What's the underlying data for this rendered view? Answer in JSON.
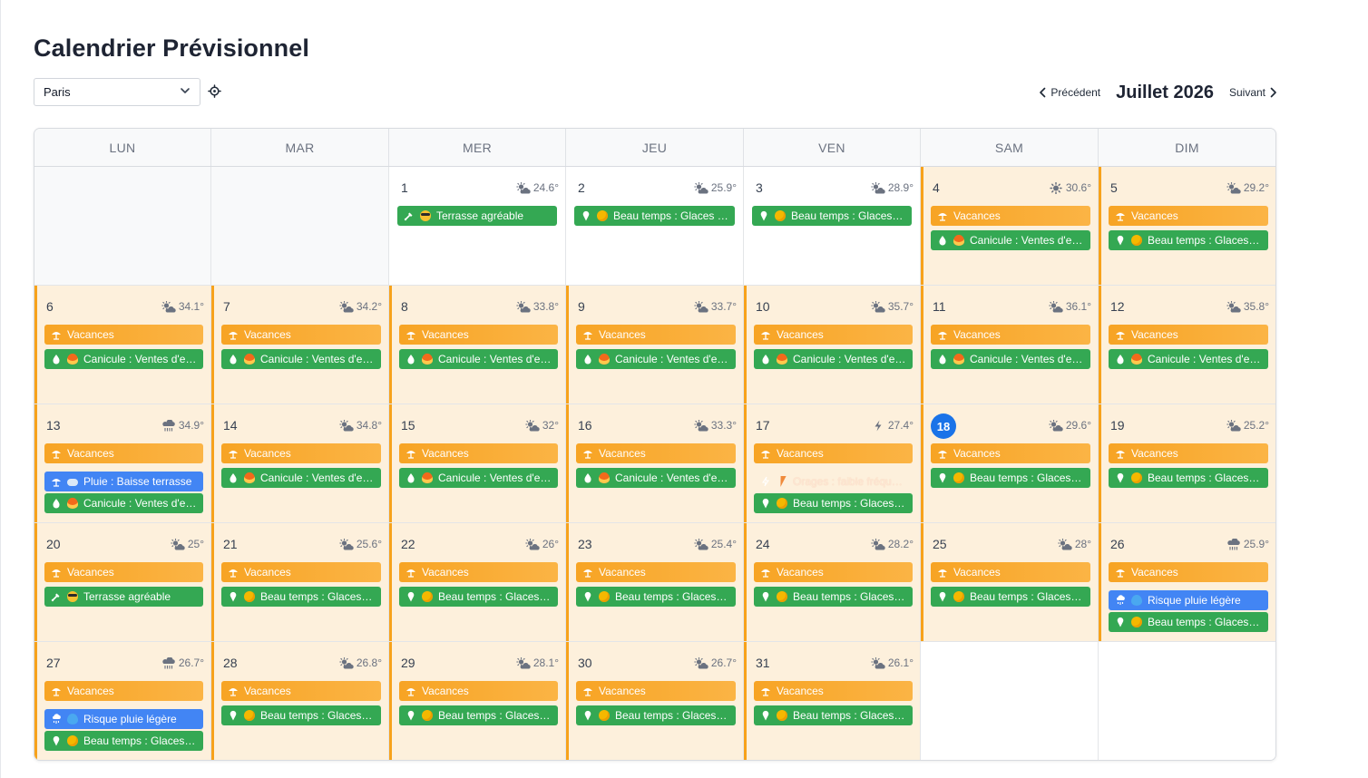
{
  "title": "Calendrier Prévisionnel",
  "city_select": {
    "value": "Paris"
  },
  "nav": {
    "prev": "Précédent",
    "month": "Juillet 2026",
    "next": "Suivant"
  },
  "weekdays": [
    "LUN",
    "MAR",
    "MER",
    "JEU",
    "VEN",
    "SAM",
    "DIM"
  ],
  "colors": {
    "vacation": "#f7a21b",
    "green": "#34a853",
    "blue": "#4285f4",
    "today": "#1a73e8"
  },
  "days": [
    {
      "type": "outside"
    },
    {
      "type": "outside"
    },
    {
      "num": "1",
      "temp": "24.6°",
      "wx": "sun-cloud",
      "vac": false,
      "events": [
        {
          "c": "green",
          "ic": "glass",
          "emo": "cool",
          "t": "Terrasse agréable"
        }
      ]
    },
    {
      "num": "2",
      "temp": "25.9°",
      "wx": "sun-cloud",
      "vac": false,
      "events": [
        {
          "c": "green",
          "ic": "icecream",
          "emo": "sun",
          "t": "Beau temps : Glaces & ..."
        }
      ]
    },
    {
      "num": "3",
      "temp": "28.9°",
      "wx": "sun-cloud",
      "vac": false,
      "events": [
        {
          "c": "green",
          "ic": "icecream",
          "emo": "sun",
          "t": "Beau temps : Glaces & ..."
        }
      ]
    },
    {
      "num": "4",
      "temp": "30.6°",
      "wx": "sun",
      "vac": true,
      "events": [
        {
          "c": "orange",
          "ic": "umbrella",
          "t": "Vacances"
        },
        {
          "c": "green",
          "ic": "drop",
          "emo": "fire",
          "t": "Canicule : Ventes d'ea..."
        }
      ]
    },
    {
      "num": "5",
      "temp": "29.2°",
      "wx": "sun-cloud",
      "vac": true,
      "events": [
        {
          "c": "orange",
          "ic": "umbrella",
          "t": "Vacances"
        },
        {
          "c": "green",
          "ic": "icecream",
          "emo": "sun",
          "t": "Beau temps : Glaces &..."
        }
      ]
    },
    {
      "num": "6",
      "temp": "34.1°",
      "wx": "sun-cloud",
      "vac": true,
      "events": [
        {
          "c": "orange",
          "ic": "umbrella",
          "t": "Vacances"
        },
        {
          "c": "green",
          "ic": "drop",
          "emo": "fire",
          "t": "Canicule : Ventes d'ea..."
        }
      ]
    },
    {
      "num": "7",
      "temp": "34.2°",
      "wx": "sun-cloud",
      "vac": true,
      "events": [
        {
          "c": "orange",
          "ic": "umbrella",
          "t": "Vacances"
        },
        {
          "c": "green",
          "ic": "drop",
          "emo": "fire",
          "t": "Canicule : Ventes d'ea..."
        }
      ]
    },
    {
      "num": "8",
      "temp": "33.8°",
      "wx": "sun-cloud",
      "vac": true,
      "events": [
        {
          "c": "orange",
          "ic": "umbrella",
          "t": "Vacances"
        },
        {
          "c": "green",
          "ic": "drop",
          "emo": "fire",
          "t": "Canicule : Ventes d'ea..."
        }
      ]
    },
    {
      "num": "9",
      "temp": "33.7°",
      "wx": "sun-cloud",
      "vac": true,
      "events": [
        {
          "c": "orange",
          "ic": "umbrella",
          "t": "Vacances"
        },
        {
          "c": "green",
          "ic": "drop",
          "emo": "fire",
          "t": "Canicule : Ventes d'ea..."
        }
      ]
    },
    {
      "num": "10",
      "temp": "35.7°",
      "wx": "sun-cloud",
      "vac": true,
      "events": [
        {
          "c": "orange",
          "ic": "umbrella",
          "t": "Vacances"
        },
        {
          "c": "green",
          "ic": "drop",
          "emo": "fire",
          "t": "Canicule : Ventes d'ea..."
        }
      ]
    },
    {
      "num": "11",
      "temp": "36.1°",
      "wx": "sun-cloud",
      "vac": true,
      "events": [
        {
          "c": "orange",
          "ic": "umbrella",
          "t": "Vacances"
        },
        {
          "c": "green",
          "ic": "drop",
          "emo": "fire",
          "t": "Canicule : Ventes d'ea..."
        }
      ]
    },
    {
      "num": "12",
      "temp": "35.8°",
      "wx": "sun-cloud",
      "vac": true,
      "events": [
        {
          "c": "orange",
          "ic": "umbrella",
          "t": "Vacances"
        },
        {
          "c": "green",
          "ic": "drop",
          "emo": "fire",
          "t": "Canicule : Ventes d'ea..."
        }
      ]
    },
    {
      "num": "13",
      "temp": "34.9°",
      "wx": "rain",
      "vac": true,
      "tight": true,
      "events": [
        {
          "c": "orange",
          "ic": "umbrella",
          "t": "Vacances"
        },
        {
          "c": "blue",
          "ic": "umbrella",
          "emo": "cloud",
          "t": "Pluie : Baisse terrasse"
        },
        {
          "c": "green",
          "ic": "drop",
          "emo": "fire",
          "t": "Canicule : Ventes d'ea..."
        }
      ]
    },
    {
      "num": "14",
      "temp": "34.8°",
      "wx": "sun-cloud",
      "vac": true,
      "events": [
        {
          "c": "orange",
          "ic": "umbrella",
          "t": "Vacances"
        },
        {
          "c": "green",
          "ic": "drop",
          "emo": "fire",
          "t": "Canicule : Ventes d'ea..."
        }
      ]
    },
    {
      "num": "15",
      "temp": "32°",
      "wx": "sun-cloud",
      "vac": true,
      "events": [
        {
          "c": "orange",
          "ic": "umbrella",
          "t": "Vacances"
        },
        {
          "c": "green",
          "ic": "drop",
          "emo": "fire",
          "t": "Canicule : Ventes d'ea..."
        }
      ]
    },
    {
      "num": "16",
      "temp": "33.3°",
      "wx": "sun-cloud",
      "vac": true,
      "events": [
        {
          "c": "orange",
          "ic": "umbrella",
          "t": "Vacances"
        },
        {
          "c": "green",
          "ic": "drop",
          "emo": "fire",
          "t": "Canicule : Ventes d'ea..."
        }
      ]
    },
    {
      "num": "17",
      "temp": "27.4°",
      "wx": "bolt",
      "vac": true,
      "tight": true,
      "events": [
        {
          "c": "orange",
          "ic": "umbrella",
          "t": "Vacances"
        },
        {
          "c": "ghost",
          "ic": "bolt",
          "emo": "bolt",
          "t": "Orages : faible fréque..."
        },
        {
          "c": "green",
          "ic": "icecream",
          "emo": "sun",
          "t": "Beau temps : Glaces &..."
        }
      ]
    },
    {
      "num": "18",
      "temp": "29.6°",
      "wx": "sun-cloud",
      "vac": true,
      "today": true,
      "events": [
        {
          "c": "orange",
          "ic": "umbrella",
          "t": "Vacances"
        },
        {
          "c": "green",
          "ic": "icecream",
          "emo": "sun",
          "t": "Beau temps : Glaces &..."
        }
      ]
    },
    {
      "num": "19",
      "temp": "25.2°",
      "wx": "sun-cloud",
      "vac": true,
      "events": [
        {
          "c": "orange",
          "ic": "umbrella",
          "t": "Vacances"
        },
        {
          "c": "green",
          "ic": "icecream",
          "emo": "sun",
          "t": "Beau temps : Glaces &..."
        }
      ]
    },
    {
      "num": "20",
      "temp": "25°",
      "wx": "sun-cloud",
      "vac": true,
      "events": [
        {
          "c": "orange",
          "ic": "umbrella",
          "t": "Vacances"
        },
        {
          "c": "green",
          "ic": "glass",
          "emo": "cool",
          "t": "Terrasse agréable"
        }
      ]
    },
    {
      "num": "21",
      "temp": "25.6°",
      "wx": "sun-cloud",
      "vac": true,
      "events": [
        {
          "c": "orange",
          "ic": "umbrella",
          "t": "Vacances"
        },
        {
          "c": "green",
          "ic": "icecream",
          "emo": "sun",
          "t": "Beau temps : Glaces &..."
        }
      ]
    },
    {
      "num": "22",
      "temp": "26°",
      "wx": "sun-cloud",
      "vac": true,
      "events": [
        {
          "c": "orange",
          "ic": "umbrella",
          "t": "Vacances"
        },
        {
          "c": "green",
          "ic": "icecream",
          "emo": "sun",
          "t": "Beau temps : Glaces &..."
        }
      ]
    },
    {
      "num": "23",
      "temp": "25.4°",
      "wx": "sun-cloud",
      "vac": true,
      "events": [
        {
          "c": "orange",
          "ic": "umbrella",
          "t": "Vacances"
        },
        {
          "c": "green",
          "ic": "icecream",
          "emo": "sun",
          "t": "Beau temps : Glaces &..."
        }
      ]
    },
    {
      "num": "24",
      "temp": "28.2°",
      "wx": "sun-cloud",
      "vac": true,
      "events": [
        {
          "c": "orange",
          "ic": "umbrella",
          "t": "Vacances"
        },
        {
          "c": "green",
          "ic": "icecream",
          "emo": "sun",
          "t": "Beau temps : Glaces &..."
        }
      ]
    },
    {
      "num": "25",
      "temp": "28°",
      "wx": "sun-cloud",
      "vac": true,
      "events": [
        {
          "c": "orange",
          "ic": "umbrella",
          "t": "Vacances"
        },
        {
          "c": "green",
          "ic": "icecream",
          "emo": "sun",
          "t": "Beau temps : Glaces &..."
        }
      ]
    },
    {
      "num": "26",
      "temp": "25.9°",
      "wx": "rain",
      "vac": true,
      "tight": true,
      "events": [
        {
          "c": "orange",
          "ic": "umbrella",
          "t": "Vacances"
        },
        {
          "c": "blue",
          "ic": "rain",
          "emo": "drop",
          "t": "Risque pluie légère"
        },
        {
          "c": "green",
          "ic": "icecream",
          "emo": "sun",
          "t": "Beau temps : Glaces &..."
        }
      ]
    },
    {
      "num": "27",
      "temp": "26.7°",
      "wx": "rain",
      "vac": true,
      "tight": true,
      "events": [
        {
          "c": "orange",
          "ic": "umbrella",
          "t": "Vacances"
        },
        {
          "c": "blue",
          "ic": "rain",
          "emo": "drop",
          "t": "Risque pluie légère"
        },
        {
          "c": "green",
          "ic": "icecream",
          "emo": "sun",
          "t": "Beau temps : Glaces &..."
        }
      ]
    },
    {
      "num": "28",
      "temp": "26.8°",
      "wx": "sun-cloud",
      "vac": true,
      "events": [
        {
          "c": "orange",
          "ic": "umbrella",
          "t": "Vacances"
        },
        {
          "c": "green",
          "ic": "icecream",
          "emo": "sun",
          "t": "Beau temps : Glaces &..."
        }
      ]
    },
    {
      "num": "29",
      "temp": "28.1°",
      "wx": "sun-cloud",
      "vac": true,
      "events": [
        {
          "c": "orange",
          "ic": "umbrella",
          "t": "Vacances"
        },
        {
          "c": "green",
          "ic": "icecream",
          "emo": "sun",
          "t": "Beau temps : Glaces &..."
        }
      ]
    },
    {
      "num": "30",
      "temp": "26.7°",
      "wx": "sun-cloud",
      "vac": true,
      "events": [
        {
          "c": "orange",
          "ic": "umbrella",
          "t": "Vacances"
        },
        {
          "c": "green",
          "ic": "icecream",
          "emo": "sun",
          "t": "Beau temps : Glaces &..."
        }
      ]
    },
    {
      "num": "31",
      "temp": "26.1°",
      "wx": "sun-cloud",
      "vac": true,
      "events": [
        {
          "c": "orange",
          "ic": "umbrella",
          "t": "Vacances"
        },
        {
          "c": "green",
          "ic": "icecream",
          "emo": "sun",
          "t": "Beau temps : Glaces &..."
        }
      ]
    },
    {
      "type": "empty"
    },
    {
      "type": "empty"
    }
  ]
}
